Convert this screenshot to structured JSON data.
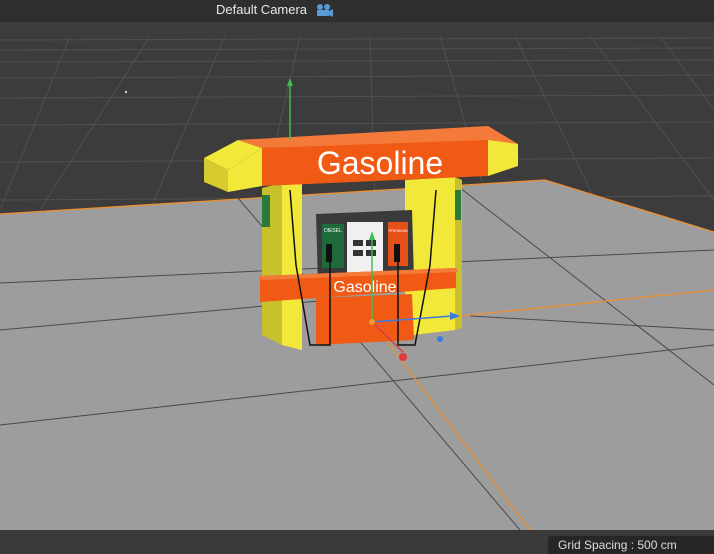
{
  "viewport": {
    "camera_label": "Default Camera",
    "camera_icon": "camera-icon",
    "grid_spacing_text": "Grid Spacing : 500 cm"
  },
  "model": {
    "canopy_sign": "Gasoline",
    "body_sign": "Gasoline",
    "left_pump_badge": "DIESEL",
    "right_pump_badge": "PREMIUM"
  },
  "colors": {
    "viewport_bg": "#3c3c3c",
    "floor": "#9d9d9d",
    "canopy_orange": "#f05a14",
    "pillar_yellow": "#f2e83a",
    "axis_x": "#e03a3a",
    "axis_y": "#3fbf4f",
    "axis_z": "#3a7be0",
    "world_x_axis": "#f09030"
  }
}
